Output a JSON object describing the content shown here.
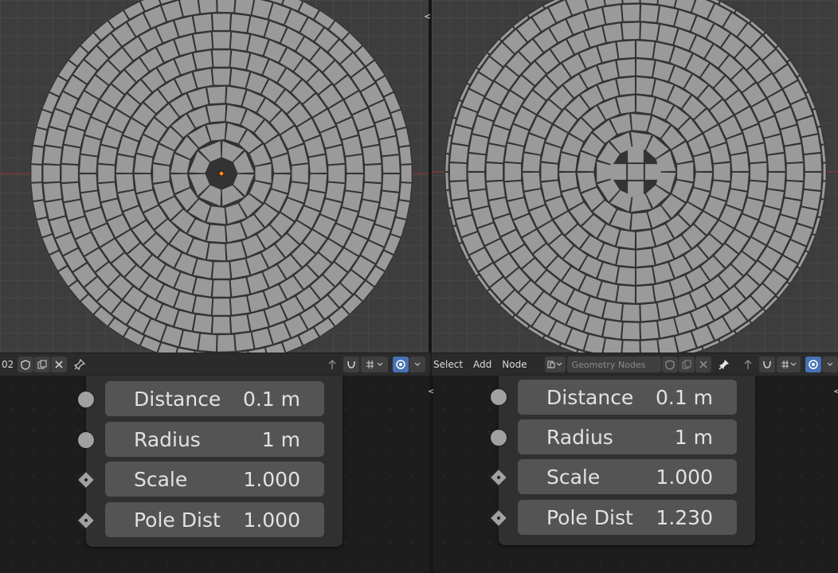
{
  "left_panel": {
    "header": {
      "datablock_suffix": "02",
      "icons": [
        "shield-icon",
        "duplicate-icon",
        "close-icon",
        "pin-icon",
        "parent-arrow-icon",
        "snap-icon",
        "snap-grid-icon",
        "overlay-icon"
      ]
    },
    "node_fields": [
      {
        "label": "Distance",
        "value": "0.1 m",
        "socket": "circle"
      },
      {
        "label": "Radius",
        "value": "1 m",
        "socket": "circle"
      },
      {
        "label": "Scale",
        "value": "1.000",
        "socket": "diamond"
      },
      {
        "label": "Pole Dist",
        "value": "1.000",
        "socket": "diamond"
      }
    ]
  },
  "right_panel": {
    "header": {
      "menus": [
        "Select",
        "Add",
        "Node"
      ],
      "tree_name_placeholder": "Geometry Nodes",
      "icons": [
        "editor-type-icon",
        "shield-icon",
        "duplicate-icon",
        "close-icon",
        "pin-icon",
        "parent-arrow-icon",
        "snap-icon",
        "snap-grid-icon",
        "overlay-icon"
      ]
    },
    "node_fields": [
      {
        "label": "Distance",
        "value": "0.1 m",
        "socket": "circle"
      },
      {
        "label": "Radius",
        "value": "1 m",
        "socket": "circle"
      },
      {
        "label": "Scale",
        "value": "1.000",
        "socket": "diamond"
      },
      {
        "label": "Pole Dist",
        "value": "1.230",
        "socket": "diamond"
      }
    ]
  },
  "colors": {
    "plate": "#9a9a9a",
    "gap": "#333333",
    "x_axis": "#8a3a3a",
    "origin": "#ff8c1a",
    "accent": "#4772b3"
  }
}
